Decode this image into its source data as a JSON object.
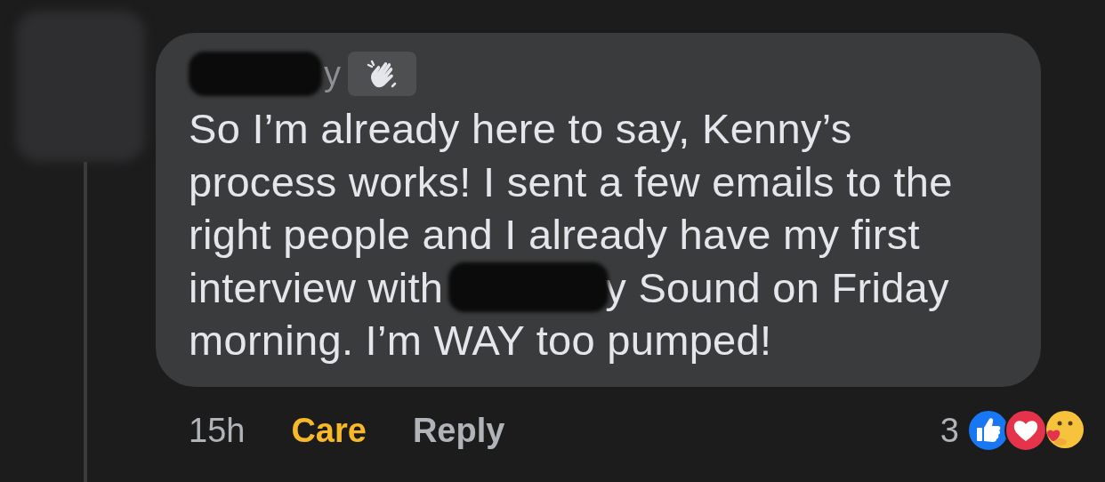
{
  "comment": {
    "author": {
      "name": "y",
      "redacted": true
    },
    "badge": {
      "kind": "wave"
    },
    "body_lines": [
      [
        {
          "kind": "text",
          "text": "So I’m already here to say, Kenny’s process works! I sent a few emails to the right people and I already have my first"
        }
      ],
      [
        {
          "kind": "text",
          "text": "interview with"
        },
        {
          "kind": "redaction"
        },
        {
          "kind": "text",
          "text": "y Sound on Friday"
        }
      ],
      [
        {
          "kind": "text",
          "text": "morning. I’m WAY too pumped!"
        }
      ]
    ],
    "time": "15h",
    "actions": [
      {
        "label": "Care",
        "selected": true
      },
      {
        "label": "Reply",
        "selected": false
      }
    ],
    "reaction_count": "3",
    "reactions": [
      {
        "kind": "like"
      },
      {
        "kind": "love"
      },
      {
        "kind": "care"
      }
    ]
  }
}
